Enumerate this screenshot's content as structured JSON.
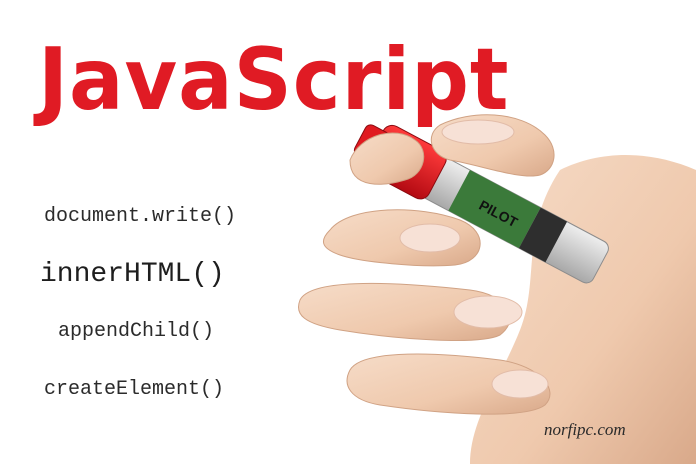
{
  "title": "JavaScript",
  "code_items": [
    "document.write()",
    "innerHTML()",
    "appendChild()",
    "createElement()"
  ],
  "marker_brand": "PILOT",
  "watermark": "norfipc.com",
  "colors": {
    "title": "#e01b24",
    "code_text": "#2b2b2b",
    "marker_cap": "#d8101a",
    "marker_body": "#3b7a3a",
    "skin": "#f1cdb4"
  },
  "icons": [
    "hand-holding-marker-illustration"
  ]
}
